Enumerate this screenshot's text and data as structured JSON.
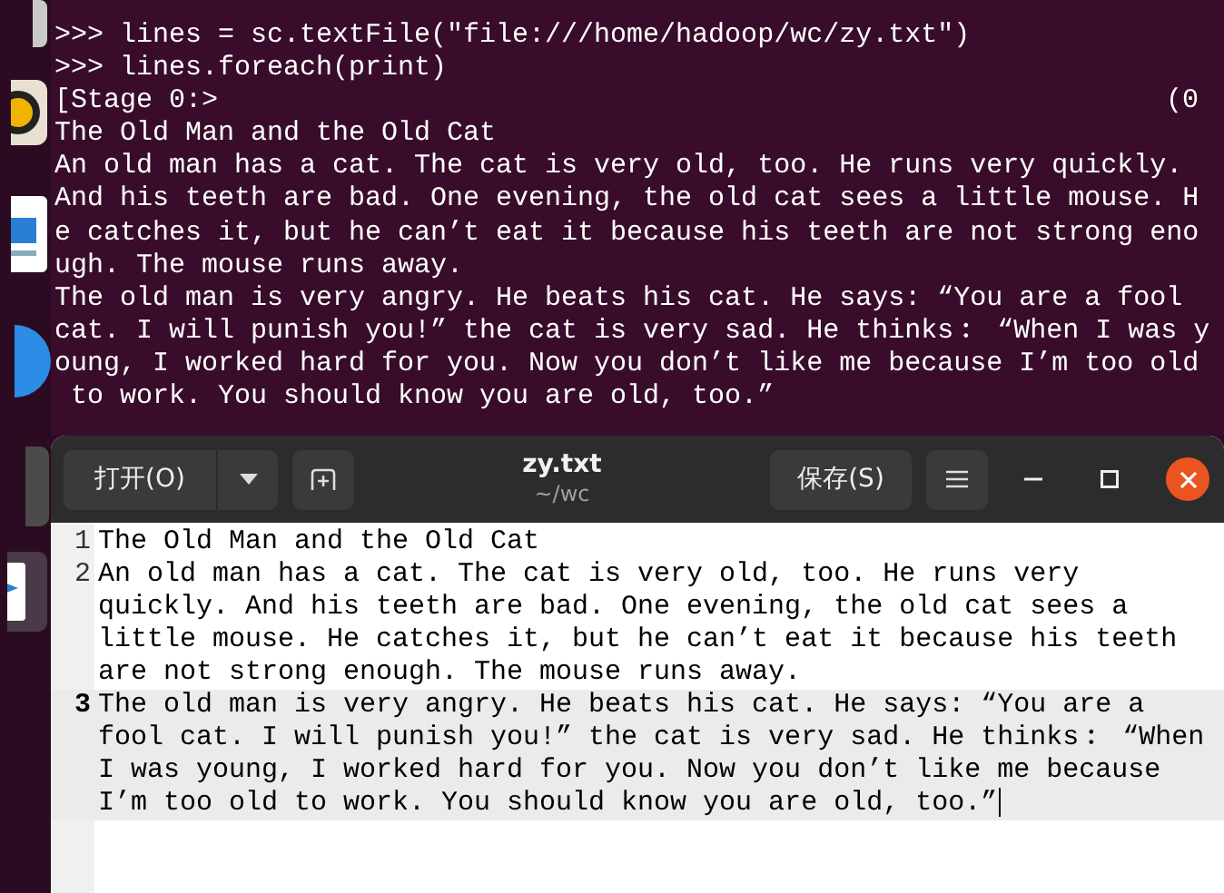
{
  "terminal": {
    "lines": [
      {
        "kind": "text",
        "text": ">>> lines = sc.textFile(\"file:///home/hadoop/wc/zy.txt\")"
      },
      {
        "kind": "text",
        "text": ">>> lines.foreach(print)"
      },
      {
        "kind": "progress",
        "left": "[Stage 0:>",
        "right": "(0"
      },
      {
        "kind": "text",
        "text": "The Old Man and the Old Cat"
      },
      {
        "kind": "text",
        "text": "An old man has a cat. The cat is very old, too. He runs very quickly."
      },
      {
        "kind": "text",
        "text": "And his teeth are bad. One evening, the old cat sees a little mouse. H"
      },
      {
        "kind": "text",
        "text": "e catches it, but he can’t eat it because his teeth are not strong eno"
      },
      {
        "kind": "text",
        "text": "ugh. The mouse runs away."
      },
      {
        "kind": "text",
        "text": "The old man is very angry. He beats his cat. He says: “You are a fool"
      },
      {
        "kind": "text",
        "text": "cat. I will punish you!” the cat is very sad. He thinks︰ “When I was y"
      },
      {
        "kind": "text",
        "text": "oung, I worked hard for you. Now you don’t like me because I’m too old"
      },
      {
        "kind": "text",
        "text": " to work. You should know you are old, too.”"
      }
    ]
  },
  "editor": {
    "open_button": "打开(O)",
    "title": "zy.txt",
    "subtitle": "~/wc",
    "save_button": "保存(S)",
    "lines": [
      {
        "number": "1",
        "current": false,
        "segments": [
          "The Old Man and the Old Cat"
        ]
      },
      {
        "number": "2",
        "current": false,
        "segments": [
          "An old man has a cat. The cat is very old, too. He runs very",
          "quickly. And his teeth are bad. One evening, the old cat sees a",
          "little mouse. He catches it, but he can’t eat it because his teeth",
          "are not strong enough. The mouse runs away."
        ]
      },
      {
        "number": "3",
        "current": true,
        "segments": [
          "The old man is very angry. He beats his cat. He says: “You are a",
          "fool cat. I will punish you!” the cat is very sad. He thinks︰ “When",
          "I was young, I worked hard for you. Now you don’t like me because",
          "I’m too old to work. You should know you are old, too.”"
        ]
      }
    ]
  }
}
